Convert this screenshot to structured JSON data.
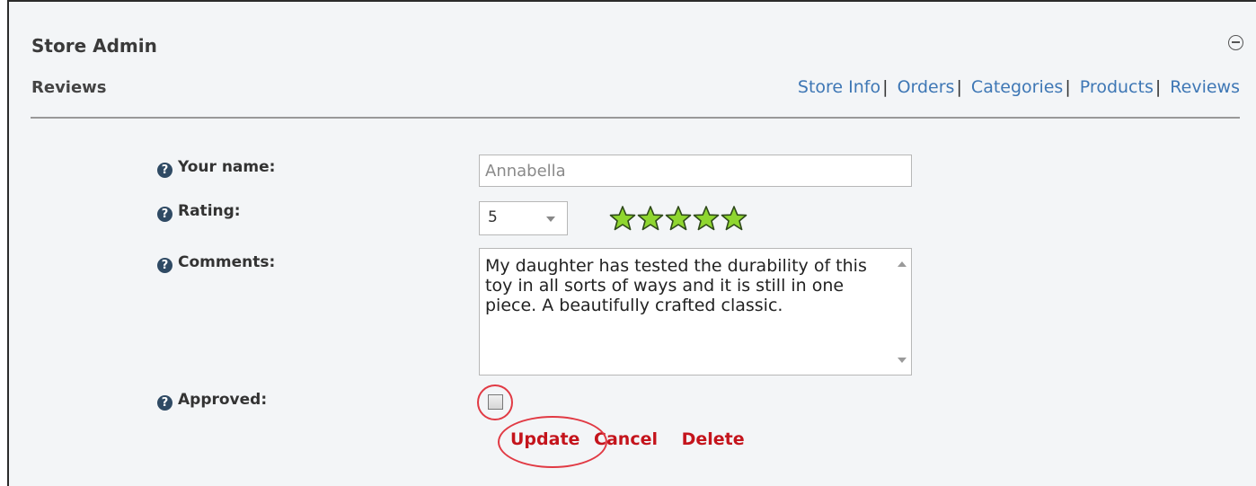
{
  "header": {
    "title": "Store Admin",
    "subtitle": "Reviews",
    "nav": [
      {
        "label": "Store Info"
      },
      {
        "label": "Orders"
      },
      {
        "label": "Categories"
      },
      {
        "label": "Products"
      },
      {
        "label": "Reviews"
      }
    ],
    "nav_separator": "|"
  },
  "form": {
    "help_glyph": "?",
    "name_label": "Your name:",
    "name_value": "Annabella",
    "rating_label": "Rating:",
    "rating_value": "5",
    "rating_stars": 5,
    "rating_max": 5,
    "comments_label": "Comments:",
    "comments_value": "My daughter has tested the durability of this toy in all sorts of ways and it is still in one piece. A beautifully crafted classic.",
    "approved_label": "Approved:",
    "approved_checked": false
  },
  "actions": {
    "update": "Update",
    "cancel": "Cancel",
    "delete": "Delete"
  },
  "colors": {
    "link": "#3e77b5",
    "action": "#c4141c",
    "highlight": "#e13a44",
    "star": "#8fd630"
  },
  "icons": {
    "collapse": "minus-circle-icon",
    "help": "question-circle-icon",
    "star": "star-icon"
  }
}
